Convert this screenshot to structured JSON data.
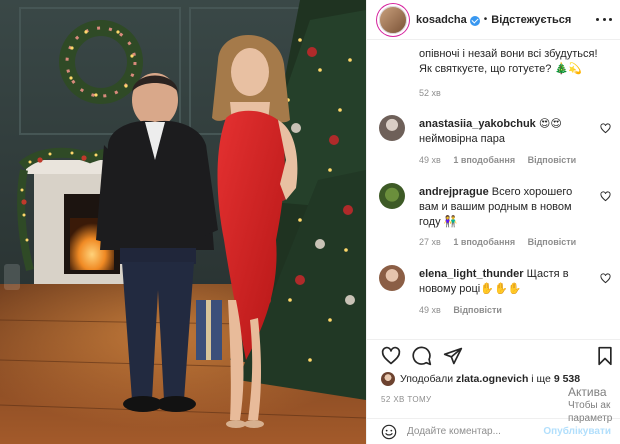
{
  "header": {
    "username": "kosadcha",
    "separator": "•",
    "follow_state": "Відстежується"
  },
  "caption": {
    "text": "опівночі і незай вони всі збудуться! Як святкуєте, що готуєте? 🎄💫",
    "time": "52 хв"
  },
  "comments": [
    {
      "username": "anastasiia_yakobchuk",
      "text": "😍😍 неймовірна пара",
      "time": "49 хв",
      "likes": "1 вподобання",
      "reply": "Відповісти"
    },
    {
      "username": "andrejprague",
      "text": "Всего хорошего вам и вашим родным в новом году 👫",
      "time": "27 хв",
      "likes": "1 вподобання",
      "reply": "Відповісти"
    },
    {
      "username": "elena_light_thunder",
      "text": "Щастя в новому році✋✋✋",
      "time": "49 хв",
      "reply": "Відповісти"
    }
  ],
  "likes": {
    "prefix": "Уподобали",
    "user": "zlata.ognevich",
    "connector": "і ще",
    "count": "9 538"
  },
  "post_time": "52 ХВ ТОМУ",
  "add_comment": {
    "placeholder": "Додайте коментар...",
    "publish_label": "Опублікувати"
  },
  "os_watermark": {
    "line1": "Актива",
    "line2": "Чтобы ак",
    "line3": "параметр"
  },
  "colors": {
    "accent_blue": "#3897f0",
    "publish_disabled": "#b2dffc",
    "muted_text": "#8e8e8e",
    "dress_red": "#d41f1f"
  }
}
